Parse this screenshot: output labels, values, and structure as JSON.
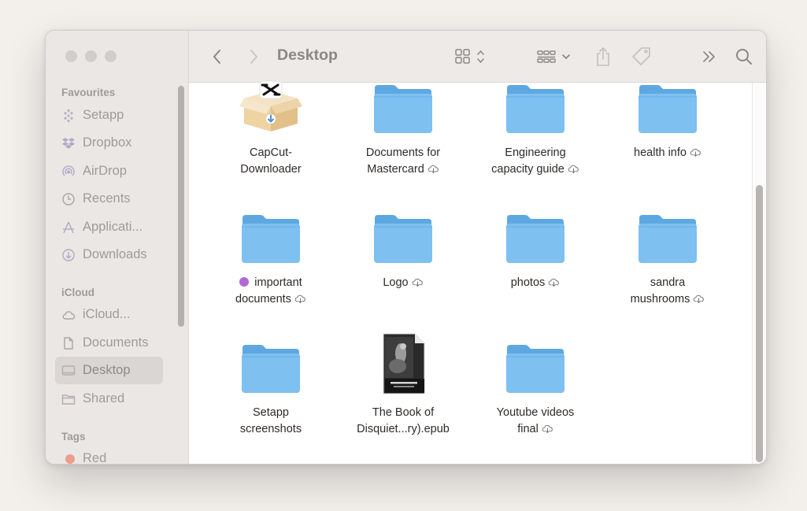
{
  "window": {
    "title": "Desktop"
  },
  "sidebar": {
    "sections": {
      "favourites": "Favourites",
      "icloud": "iCloud",
      "tags": "Tags"
    },
    "favourites": [
      {
        "label": "Setapp",
        "icon": "setapp-icon"
      },
      {
        "label": "Dropbox",
        "icon": "dropbox-icon"
      },
      {
        "label": "AirDrop",
        "icon": "airdrop-icon"
      },
      {
        "label": "Recents",
        "icon": "clock-icon"
      },
      {
        "label": "Applicati...",
        "icon": "applications-icon"
      },
      {
        "label": "Downloads",
        "icon": "download-icon"
      }
    ],
    "icloud": [
      {
        "label": "iCloud...",
        "icon": "cloud-icon"
      },
      {
        "label": "Documents",
        "icon": "document-icon"
      },
      {
        "label": "Desktop",
        "icon": "desktop-icon",
        "selected": true
      },
      {
        "label": "Shared",
        "icon": "shared-folder-icon"
      }
    ],
    "tags": [
      {
        "label": "Red",
        "color": "#eb9d8e"
      }
    ]
  },
  "files": [
    {
      "line1": "CapCut-",
      "line2": "Downloader",
      "type": "package",
      "cloud": false
    },
    {
      "line1": "Documents for",
      "line2": "Mastercard",
      "type": "folder",
      "cloud": true
    },
    {
      "line1": "Engineering",
      "line2": "capacity guide",
      "type": "folder",
      "cloud": true
    },
    {
      "line1": "health info",
      "line2": "",
      "type": "folder",
      "cloud": true
    },
    {
      "line1": "important",
      "line2": "documents",
      "type": "folder",
      "cloud": true,
      "tag_color": "#b169d8"
    },
    {
      "line1": "Logo",
      "line2": "",
      "type": "folder",
      "cloud": true
    },
    {
      "line1": "photos",
      "line2": "",
      "type": "folder",
      "cloud": true
    },
    {
      "line1": "sandra",
      "line2": "mushrooms",
      "type": "folder",
      "cloud": true
    },
    {
      "line1": "Setapp",
      "line2": "screenshots",
      "type": "folder",
      "cloud": false
    },
    {
      "line1": "The Book of",
      "line2": "Disquiet...ry).epub",
      "type": "book",
      "cloud": false
    },
    {
      "line1": "Youtube videos",
      "line2": "final",
      "type": "folder",
      "cloud": true
    }
  ],
  "colors": {
    "folder": "#7ec0f0",
    "folder_tab": "#5ea8e2",
    "sidebar_bg": "#ebe7e5",
    "selected_bg": "#dad6d3"
  }
}
